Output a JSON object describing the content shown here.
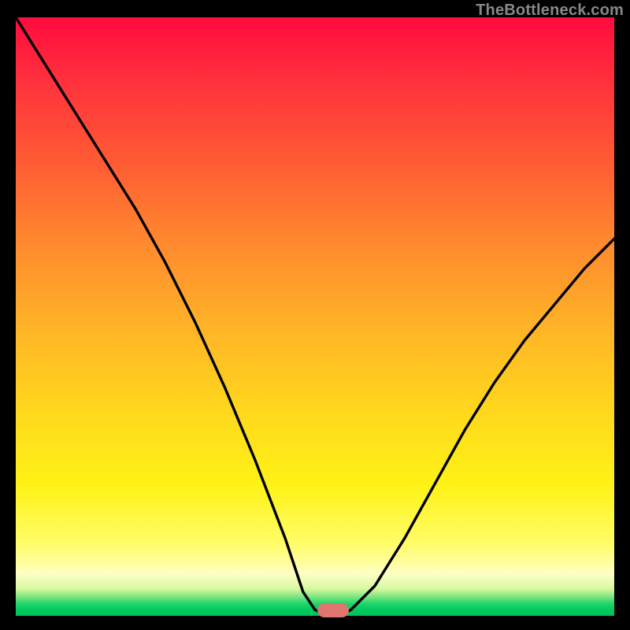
{
  "watermark": "TheBottleneck.com",
  "colors": {
    "background": "#000000",
    "curve_stroke": "#000000",
    "bump": "#e0746e",
    "watermark": "#888888"
  },
  "chart_data": {
    "type": "line",
    "title": "",
    "xlabel": "",
    "ylabel": "",
    "xlim": [
      0,
      100
    ],
    "ylim": [
      0,
      100
    ],
    "grid": false,
    "legend": false,
    "series": [
      {
        "name": "bottleneck-curve",
        "x": [
          0,
          5,
          10,
          15,
          20,
          25,
          30,
          35,
          40,
          45,
          48,
          50,
          52,
          54,
          56,
          60,
          65,
          70,
          75,
          80,
          85,
          90,
          95,
          100
        ],
        "values": [
          100,
          92,
          84,
          76,
          68,
          59,
          49,
          38,
          26,
          13,
          4,
          1,
          0,
          0,
          1,
          5,
          13,
          22,
          31,
          39,
          46,
          52,
          58,
          63
        ]
      }
    ],
    "annotations": [
      {
        "name": "minimum-marker",
        "x": 53,
        "y": 0,
        "shape": "rounded-rect",
        "color": "#e0746e"
      }
    ]
  }
}
